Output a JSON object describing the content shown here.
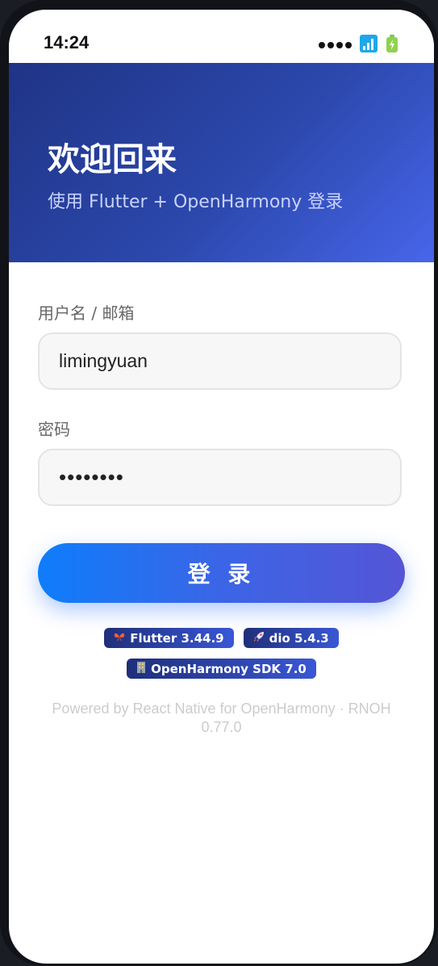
{
  "status_bar": {
    "time": "14:24",
    "icons": [
      "signal-dots-icon",
      "wifi-icon",
      "battery-icon"
    ]
  },
  "header": {
    "title": "欢迎回来",
    "subtitle": "使用 Flutter + OpenHarmony 登录"
  },
  "form": {
    "username_label": "用户名 / 邮箱",
    "username_value": "limingyuan",
    "password_label": "密码",
    "password_value": "••••••••",
    "login_label": "登 录"
  },
  "badges": [
    {
      "icon": "butterfly-icon",
      "label": "Flutter 3.44.9"
    },
    {
      "icon": "rocket-icon",
      "label": "dio 5.4.3"
    },
    {
      "icon": "building-icon",
      "label": "OpenHarmony SDK 7.0"
    }
  ],
  "footer": {
    "powered_text": "Powered by React Native for OpenHarmony · RNOH 0.77.0"
  },
  "colors": {
    "accent": "#0e7dfb",
    "header_start": "#1f3485",
    "header_end": "#4766ea",
    "badge_start": "#1f2f7a",
    "badge_end": "#3a57d6"
  }
}
